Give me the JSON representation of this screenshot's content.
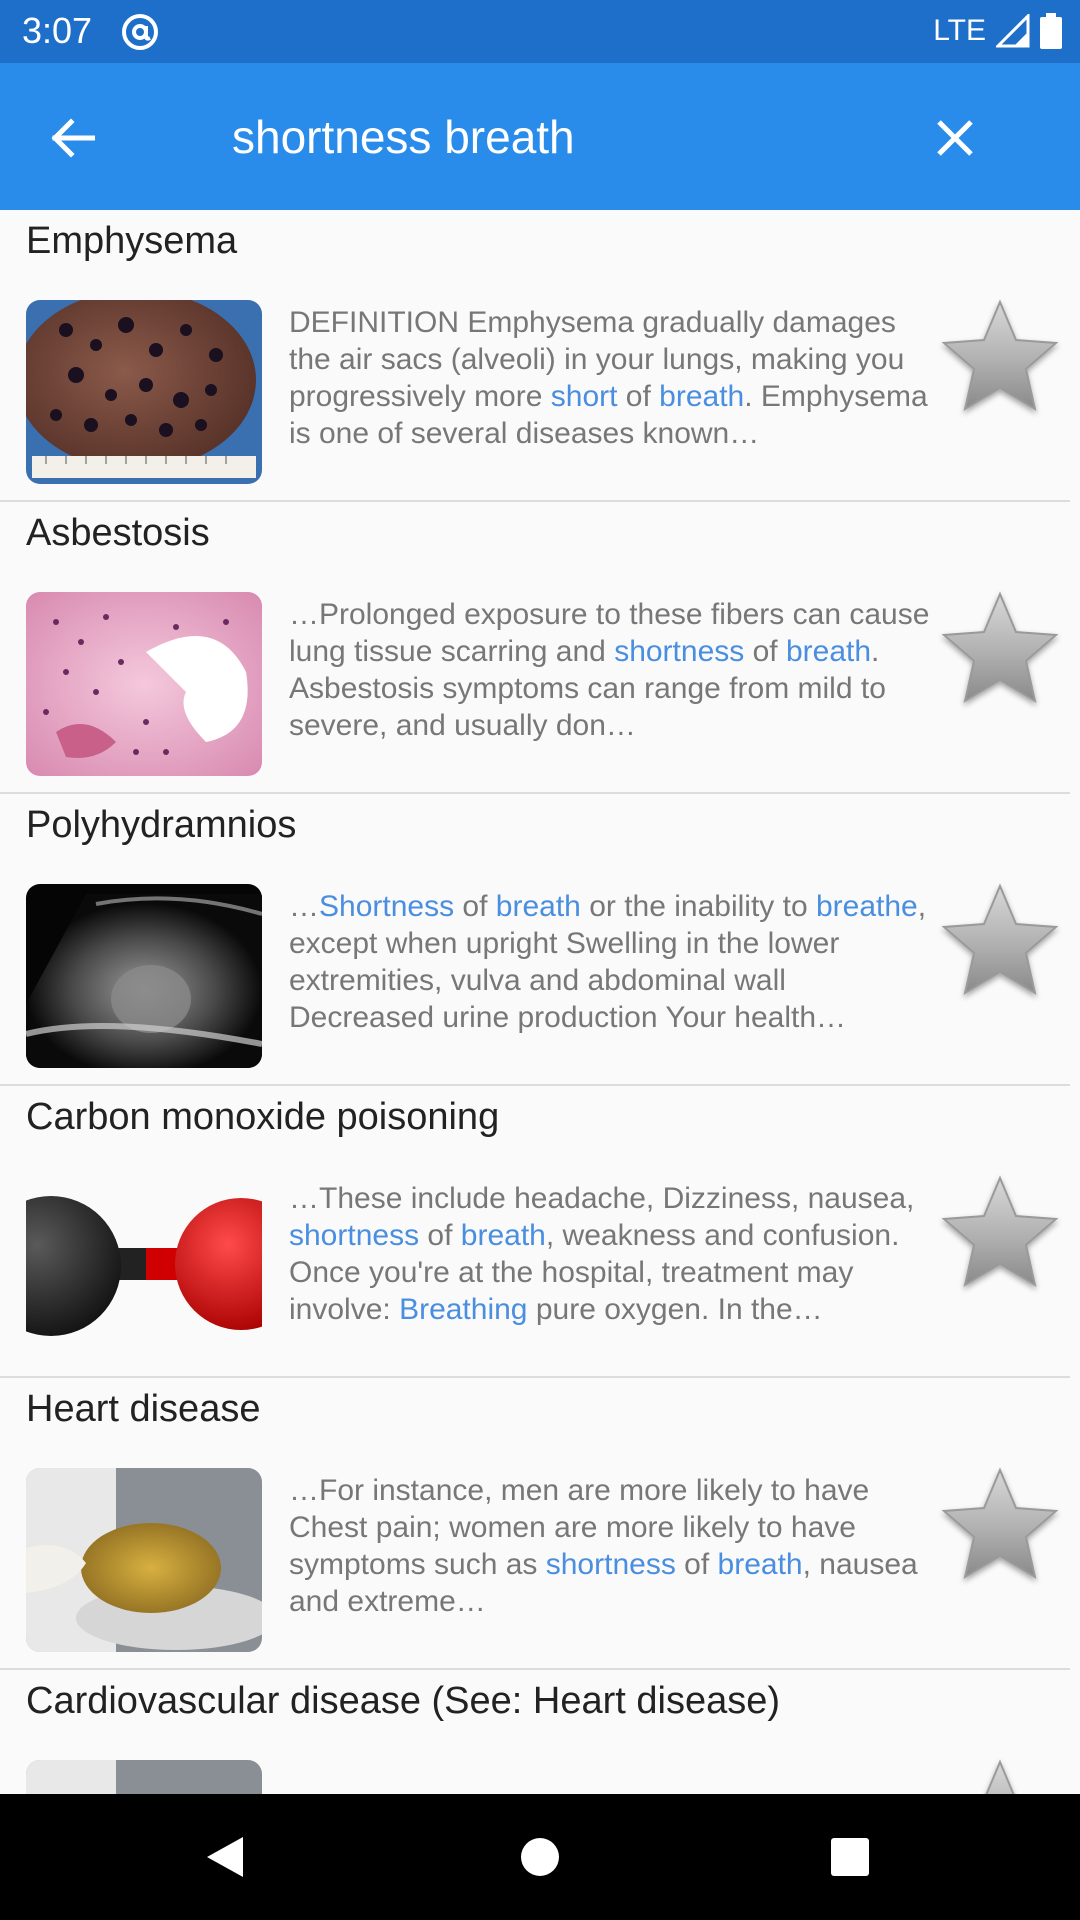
{
  "status_bar": {
    "time": "3:07",
    "network": "LTE"
  },
  "app_bar": {
    "query": "shortness breath",
    "back_icon": "arrow-back-icon",
    "clear_icon": "close-icon"
  },
  "results": [
    {
      "title": "Emphysema",
      "thumbnail": "lung-specimen-image",
      "snippet": [
        {
          "t": "DEFINITION Emphysema gradually damages the air sacs (alveoli) in your lungs, making you progressively more "
        },
        {
          "t": "short",
          "h": true
        },
        {
          "t": " of "
        },
        {
          "t": "breath",
          "h": true
        },
        {
          "t": ". Emphysema is one of several diseases known…"
        }
      ]
    },
    {
      "title": "Asbestosis",
      "thumbnail": "lung-tissue-histology-image",
      "snippet": [
        {
          "t": "…Prolonged exposure to these fibers can cause lung tissue scarring and "
        },
        {
          "t": "shortness",
          "h": true
        },
        {
          "t": " of "
        },
        {
          "t": "breath",
          "h": true
        },
        {
          "t": ". Asbestosis symptoms can range from mild to severe, and usually don…"
        }
      ]
    },
    {
      "title": "Polyhydramnios",
      "thumbnail": "ultrasound-image",
      "snippet": [
        {
          "t": "…"
        },
        {
          "t": "Shortness",
          "h": true
        },
        {
          "t": " of "
        },
        {
          "t": "breath",
          "h": true
        },
        {
          "t": " or the inability to "
        },
        {
          "t": "breathe",
          "h": true
        },
        {
          "t": ", except when upright Swelling in the lower extremities, vulva and abdominal wall Decreased urine production Your health…"
        }
      ]
    },
    {
      "title": "Carbon monoxide poisoning",
      "thumbnail": "co-molecule-model-image",
      "snippet": [
        {
          "t": "…These include headache, Dizziness, nausea, "
        },
        {
          "t": "shortness",
          "h": true
        },
        {
          "t": " of "
        },
        {
          "t": "breath",
          "h": true
        },
        {
          "t": ", weakness and confusion. Once you're at the hospital, treatment may involve: "
        },
        {
          "t": "Breathing",
          "h": true
        },
        {
          "t": " pure oxygen. In the…"
        }
      ]
    },
    {
      "title": "Heart disease",
      "thumbnail": "heart-specimen-image",
      "snippet": [
        {
          "t": "…For instance, men are more likely to have Chest pain; women are more likely to have symptoms such as "
        },
        {
          "t": "shortness",
          "h": true
        },
        {
          "t": " of "
        },
        {
          "t": "breath",
          "h": true
        },
        {
          "t": ", nausea and extreme…"
        }
      ]
    },
    {
      "title": "Cardiovascular disease (See: Heart disease)",
      "thumbnail": "heart-specimen-image",
      "snippet": []
    }
  ],
  "colors": {
    "status_bar": "#1e6fca",
    "app_bar": "#2a8cea",
    "highlight": "#4a8ee0",
    "snippet_text": "#777777"
  },
  "nav_bar": {
    "back_icon": "nav-back-icon",
    "home_icon": "nav-home-icon",
    "recents_icon": "nav-recents-icon"
  }
}
